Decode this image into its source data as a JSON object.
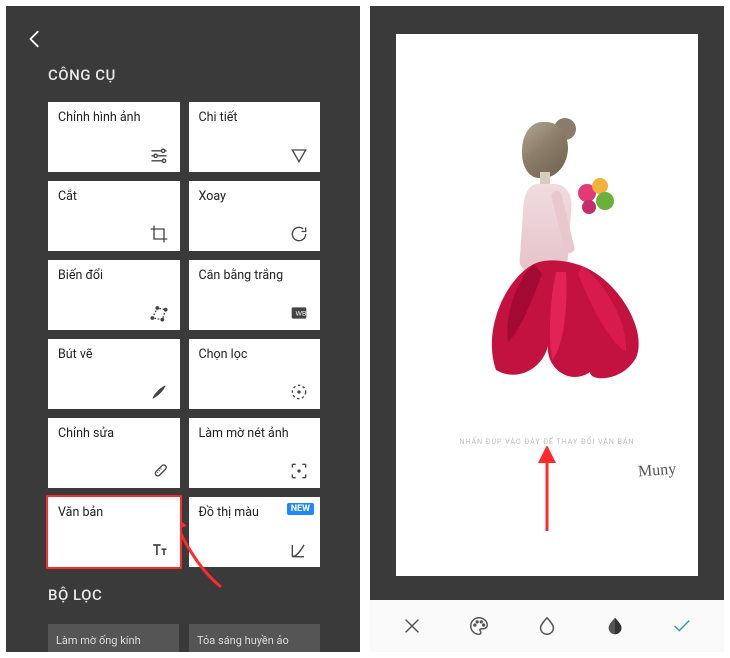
{
  "left": {
    "section_tools": "CÔNG CỤ",
    "section_filters": "BỘ LỌC",
    "tools": [
      {
        "label": "Chỉnh hình ảnh",
        "icon": "tune-icon"
      },
      {
        "label": "Chi tiết",
        "icon": "details-icon"
      },
      {
        "label": "Cắt",
        "icon": "crop-icon"
      },
      {
        "label": "Xoay",
        "icon": "rotate-icon"
      },
      {
        "label": "Biến đổi",
        "icon": "transform-icon"
      },
      {
        "label": "Cân bằng trắng",
        "icon": "whitebalance-icon"
      },
      {
        "label": "Bút vẽ",
        "icon": "brush-icon"
      },
      {
        "label": "Chọn lọc",
        "icon": "selective-icon"
      },
      {
        "label": "Chỉnh sửa",
        "icon": "healing-icon"
      },
      {
        "label": "Làm mờ nét ảnh",
        "icon": "vignette-icon"
      },
      {
        "label": "Văn bản",
        "icon": "text-icon",
        "highlighted": true
      },
      {
        "label": "Đồ thị màu",
        "icon": "curves-icon",
        "badge": "NEW"
      }
    ],
    "filters": [
      {
        "label": "Làm mờ ống kính"
      },
      {
        "label": "Tỏa sáng huyền ảo"
      }
    ]
  },
  "right": {
    "text_prompt": "NHẤN ĐÚP VÀO ĐÂY ĐỂ THAY ĐỔI VĂN BẢN",
    "signature": "Muny",
    "toolbar": [
      {
        "name": "close-icon"
      },
      {
        "name": "palette-icon"
      },
      {
        "name": "opacity-icon"
      },
      {
        "name": "font-style-icon"
      },
      {
        "name": "check-icon"
      }
    ]
  },
  "colors": {
    "highlight": "#ff2a2a",
    "badge": "#1e88ff",
    "accent_check": "#2a9faa"
  }
}
